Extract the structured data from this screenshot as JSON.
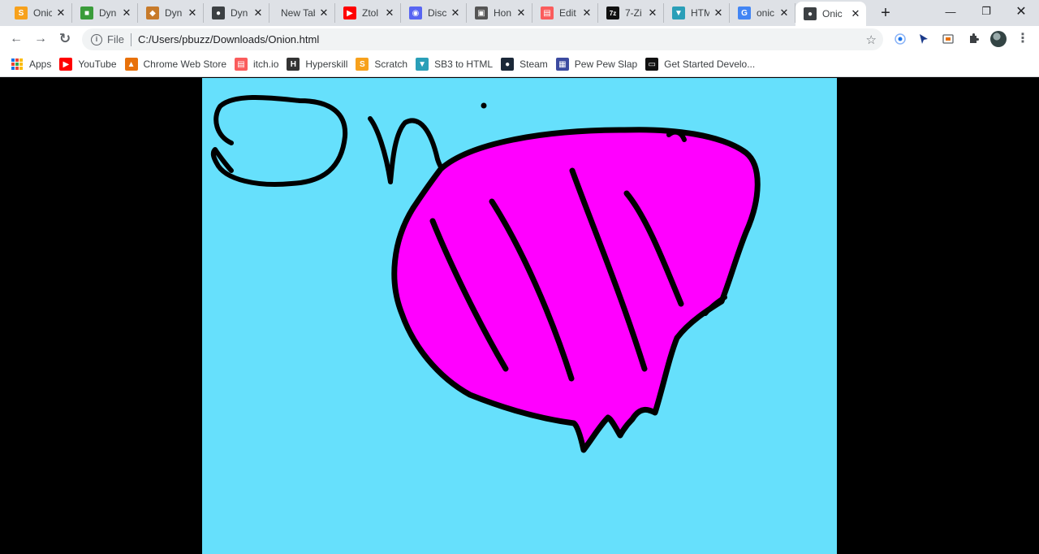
{
  "tabs": [
    {
      "title": "Onic",
      "icon": "scratch-icon",
      "color": "#f7a11c",
      "glyph": "S"
    },
    {
      "title": "Dyn",
      "icon": "cube-icon",
      "color": "#3a9c3a",
      "glyph": "■"
    },
    {
      "title": "Dyn",
      "icon": "game-icon",
      "color": "#c77a2a",
      "glyph": "◆"
    },
    {
      "title": "Dyn",
      "icon": "globe-icon",
      "color": "#3c4043",
      "glyph": "●"
    },
    {
      "title": "New Tab",
      "icon": "",
      "color": "transparent",
      "glyph": ""
    },
    {
      "title": "Ztol",
      "icon": "youtube-icon",
      "color": "#ff0000",
      "glyph": "▶"
    },
    {
      "title": "Disc",
      "icon": "discord-icon",
      "color": "#5865f2",
      "glyph": "◉"
    },
    {
      "title": "Hon",
      "icon": "box-icon",
      "color": "#555555",
      "glyph": "▣"
    },
    {
      "title": "Edit",
      "icon": "itchio-icon",
      "color": "#fa5c5c",
      "glyph": "▤"
    },
    {
      "title": "7-Zi",
      "icon": "sevenzip-icon",
      "color": "#111111",
      "glyph": "7z"
    },
    {
      "title": "HTM",
      "icon": "sb3-icon",
      "color": "#2a9fb8",
      "glyph": "▼"
    },
    {
      "title": "onic",
      "icon": "google-icon",
      "color": "#4285f4",
      "glyph": "G"
    },
    {
      "title": "Onic",
      "icon": "globe-icon",
      "color": "#3c4043",
      "glyph": "●"
    }
  ],
  "toolbar": {
    "scheme": "File",
    "url": "C:/Users/pbuzz/Downloads/Onion.html"
  },
  "bookmarks": [
    {
      "label": "Apps",
      "icon": "apps-icon",
      "color": "",
      "glyph": ""
    },
    {
      "label": "YouTube",
      "icon": "youtube-icon",
      "color": "#ff0000",
      "glyph": "▶"
    },
    {
      "label": "Chrome Web Store",
      "icon": "webstore-icon",
      "color": "#e8710a",
      "glyph": "▲"
    },
    {
      "label": "itch.io",
      "icon": "itchio-icon",
      "color": "#fa5c5c",
      "glyph": "▤"
    },
    {
      "label": "Hyperskill",
      "icon": "hyperskill-icon",
      "color": "#333333",
      "glyph": "H"
    },
    {
      "label": "Scratch",
      "icon": "scratch-icon",
      "color": "#f7a11c",
      "glyph": "S"
    },
    {
      "label": "SB3 to HTML",
      "icon": "sb3-icon",
      "color": "#2a9fb8",
      "glyph": "▼"
    },
    {
      "label": "Steam",
      "icon": "steam-icon",
      "color": "#1b2838",
      "glyph": "●"
    },
    {
      "label": "Pew Pew Slap",
      "icon": "page-icon",
      "color": "#3c4ba0",
      "glyph": "▦"
    },
    {
      "label": "Get Started Develo...",
      "icon": "terminal-icon",
      "color": "#111111",
      "glyph": "▭"
    }
  ],
  "colors": {
    "canvas_bg": "#66e0fc",
    "onion_fill": "#ff00ff",
    "stroke": "#000000"
  }
}
